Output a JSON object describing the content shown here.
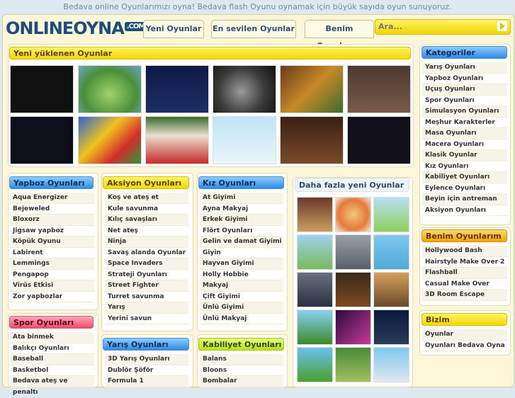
{
  "tagline": "Bedava online Oyunlarımızı oyna! Bedava flash Oyunu oynamak için büyük sayıda oyun sunuyoruz.",
  "logo": {
    "name": "ONLINEOYNA",
    "suffix": ".COM"
  },
  "nav": [
    "Yeni Oyunlar",
    "En sevilen Oyunlar",
    "Benim Oyunlarım"
  ],
  "search": {
    "placeholder": "Ara..."
  },
  "colors": {
    "accent_yellow": "#f4d700",
    "accent_blue": "#2f8be3",
    "brand": "#1b4d7e"
  },
  "new_games": {
    "title": "Yeni yüklenen Oyunlar"
  },
  "sections": {
    "yapboz": {
      "title": "Yapboz Oyunları",
      "items": [
        "Aqua Energizer",
        "Bejeweled",
        "Bloxorz",
        "Jigsaw yapboz",
        "Köpük Oyunu",
        "Labirent",
        "Lemmings",
        "Pengapop",
        "Virüs Etkisi",
        "Zor yapbozlar"
      ]
    },
    "aksiyon": {
      "title": "Aksiyon Oyunları",
      "items": [
        "Koş ve ateş et",
        "Kule savunma",
        "Kılıç savaşları",
        "Net ateş",
        "Ninja",
        "Savaş alanda Oyunlar",
        "Space Invaders",
        "Strateji Oyunları",
        "Street Fighter",
        "Turret savunma",
        "Yarış",
        "Yerini savun"
      ]
    },
    "kiz": {
      "title": "Kız Oyunları",
      "items": [
        "At Giyimi",
        "Ayna Makyaj",
        "Erkek Giyimi",
        "Flört Oyunları",
        "Gelin ve damat Giyimi",
        "Giyin",
        "Hayvan Giyimi",
        "Holly Hobbie",
        "Makyaj",
        "Çift Giyimi",
        "Ünlü Giyimi",
        "Ünlü Makyaj"
      ]
    },
    "spor": {
      "title": "Spor Oyunları",
      "items": [
        "Ata binmek",
        "Balıkçı Oyunları",
        "Baseball",
        "Basketbol",
        "Bedava ateş ve penaltı"
      ]
    },
    "yaris": {
      "title": "Yarış Oyunları",
      "items": [
        "3D Yarış Oyunları",
        "Dublör Şöför",
        "Formula 1"
      ]
    },
    "kabiliyet": {
      "title": "Kabiliyet Oyunları",
      "items": [
        "Balans",
        "Bloons",
        "Bombalar"
      ]
    },
    "more": {
      "title": "Daha fazla yeni Oyunlar"
    }
  },
  "sidebar": {
    "kategoriler": {
      "title": "Kategoriler",
      "items": [
        "Yarış Oyunları",
        "Yapboz Oyunları",
        "Uçuş Oyunları",
        "Spor Oyunları",
        "Simulasyon Oyunları",
        "Meşhur Karakterler",
        "Masa Oyunları",
        "Macera Oyunları",
        "Klasik Oyunlar",
        "Kız Oyunları",
        "Kabiliyet Oyunları",
        "Eylence Oyunları",
        "Beyin için antreman",
        "Aksiyon Oyunları"
      ]
    },
    "benim": {
      "title": "Benim Oyunlarım",
      "items": [
        "Hollywood Bash",
        "Hairstyle Make Over 2",
        "Flashball",
        "Casual Make Over",
        "3D Room Escape"
      ]
    },
    "bizim": {
      "title": "Bizim arkadaşlarımız",
      "items": [
        "Oyunlar",
        "Oyunları Bedava Oyna"
      ]
    }
  }
}
